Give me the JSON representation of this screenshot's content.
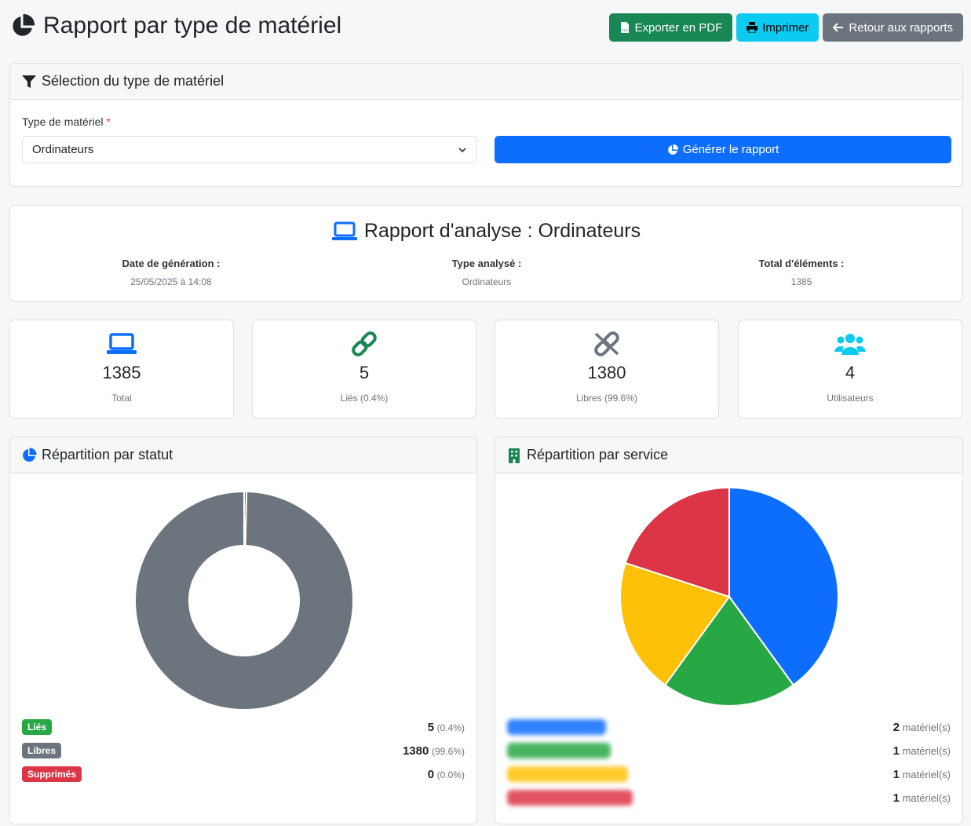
{
  "header": {
    "title": "Rapport par type de matériel",
    "export_pdf": "Exporter en PDF",
    "print": "Imprimer",
    "back": "Retour aux rapports"
  },
  "selection": {
    "header": "Sélection du type de matériel",
    "field_label": "Type de matériel",
    "required_mark": "*",
    "selected": "Ordinateurs",
    "generate": "Générer le rapport"
  },
  "report": {
    "title": "Rapport d'analyse : Ordinateurs",
    "meta": [
      {
        "label": "Date de génération :",
        "value": "25/05/2025 à 14:08"
      },
      {
        "label": "Type analysé :",
        "value": "Ordinateurs"
      },
      {
        "label": "Total d'éléments :",
        "value": "1385"
      }
    ]
  },
  "stats": [
    {
      "value": "1385",
      "label": "Total",
      "icon": "laptop-icon",
      "color": "#0d6efd"
    },
    {
      "value": "5",
      "label": "Liés (0.4%)",
      "icon": "link-icon",
      "color": "#198754"
    },
    {
      "value": "1380",
      "label": "Libres (99.6%)",
      "icon": "unlink-icon",
      "color": "#6c757d"
    },
    {
      "value": "4",
      "label": "Utilisateurs",
      "icon": "users-icon",
      "color": "#0dcaf0"
    }
  ],
  "status_card": {
    "header": "Répartition par statut",
    "legend": [
      {
        "label": "Liés",
        "count": "5",
        "pct": "(0.4%)",
        "color": "#28a745"
      },
      {
        "label": "Libres",
        "count": "1380",
        "pct": "(99.6%)",
        "color": "#6c757d"
      },
      {
        "label": "Supprimés",
        "count": "0",
        "pct": "(0.0%)",
        "color": "#dc3545"
      }
    ]
  },
  "service_card": {
    "header": "Répartition par service",
    "unit": "matériel(s)",
    "legend": [
      {
        "count": "2",
        "color": "#0d6efd"
      },
      {
        "count": "1",
        "color": "#28a745"
      },
      {
        "count": "1",
        "color": "#ffc107"
      },
      {
        "count": "1",
        "color": "#dc3545"
      }
    ]
  },
  "chart_data": [
    {
      "type": "pie",
      "variant": "doughnut",
      "categories": [
        "Liés",
        "Libres",
        "Supprimés"
      ],
      "values": [
        5,
        1380,
        0
      ],
      "colors": [
        "#28a745",
        "#6c757d",
        "#dc3545"
      ]
    },
    {
      "type": "pie",
      "values": [
        2,
        1,
        1,
        1
      ],
      "colors": [
        "#0d6efd",
        "#28a745",
        "#ffc107",
        "#dc3545"
      ]
    }
  ]
}
